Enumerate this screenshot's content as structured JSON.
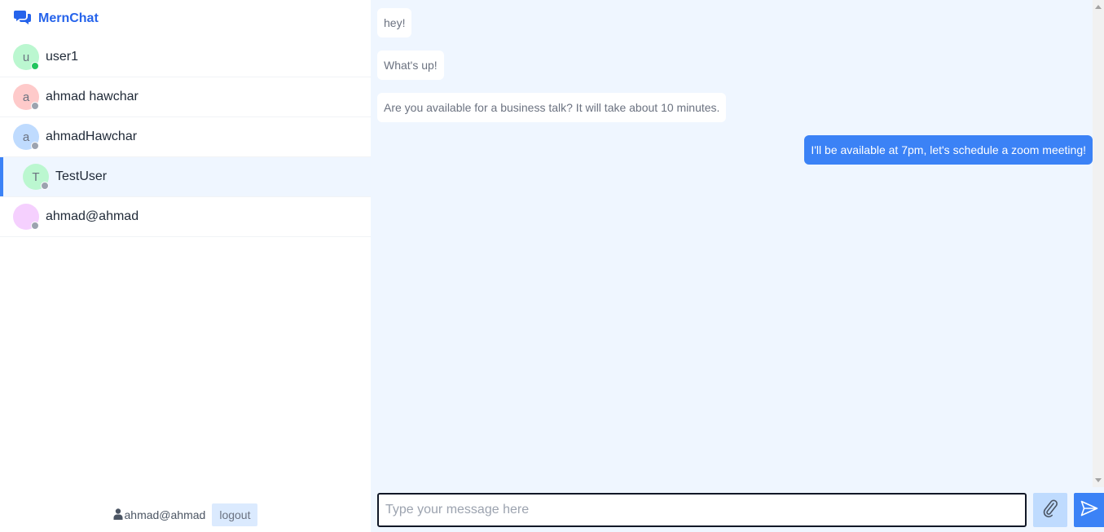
{
  "app": {
    "name": "MernChat",
    "logo_icon": "chat-bubbles-icon",
    "accent": "#2563eb"
  },
  "contacts": [
    {
      "initial": "u",
      "name": "user1",
      "avatar_color": "#bbf7d0",
      "online": true,
      "selected": false
    },
    {
      "initial": "a",
      "name": "ahmad hawchar",
      "avatar_color": "#fecaca",
      "online": false,
      "selected": false
    },
    {
      "initial": "a",
      "name": "ahmadHawchar",
      "avatar_color": "#bfdbfe",
      "online": false,
      "selected": false
    },
    {
      "initial": "T",
      "name": "TestUser",
      "avatar_color": "#bbf7d0",
      "online": false,
      "selected": true
    },
    {
      "initial": "",
      "name": "ahmad@ahmad",
      "avatar_color": "#f5d0fe",
      "online": false,
      "selected": false
    }
  ],
  "status_colors": {
    "online": "#22c55e",
    "offline": "#9ca3af"
  },
  "current_user": {
    "username": "ahmad@ahmad",
    "icon": "user-icon",
    "logout_label": "logout"
  },
  "messages": [
    {
      "direction": "in",
      "text": "hey!"
    },
    {
      "direction": "in",
      "text": "What's up!"
    },
    {
      "direction": "in",
      "text": "Are you available for a business talk? It will take about 10 minutes."
    },
    {
      "direction": "out",
      "text": "I'll be available at 7pm, let's schedule a zoom meeting!"
    }
  ],
  "composer": {
    "placeholder": "Type your message here",
    "value": "",
    "attach_icon": "paperclip-icon",
    "send_icon": "send-icon"
  }
}
